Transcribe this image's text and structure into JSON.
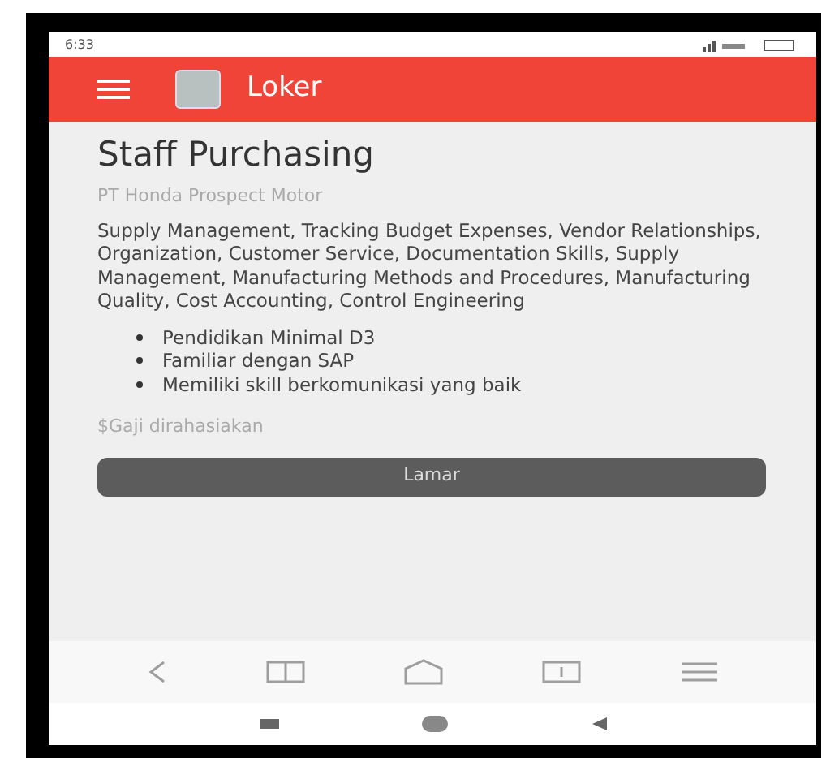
{
  "status_bar": {
    "time": "6:33"
  },
  "app_bar": {
    "title": "Loker"
  },
  "job": {
    "title": "Staff Purchasing",
    "company": "PT Honda Prospect Motor",
    "description": "Supply Management, Tracking Budget Expenses, Vendor Relationships, Organization, Customer Service, Documentation Skills, Supply Management, Manufacturing Methods and Procedures, Manufacturing Quality, Cost Accounting, Control Engineering",
    "requirements": [
      "Pendidikan Minimal D3",
      "Familiar dengan SAP",
      "Memiliki skill berkomunikasi yang baik"
    ],
    "salary": "$Gaji dirahasiakan",
    "apply_button": "Lamar"
  },
  "browser_toolbar": [
    {
      "kind": "back"
    },
    {
      "kind": "book"
    },
    {
      "kind": "home"
    },
    {
      "kind": "tabs"
    },
    {
      "kind": "menu"
    }
  ],
  "nav_bar": [
    {
      "kind": "recents"
    },
    {
      "kind": "home"
    },
    {
      "kind": "back"
    }
  ]
}
